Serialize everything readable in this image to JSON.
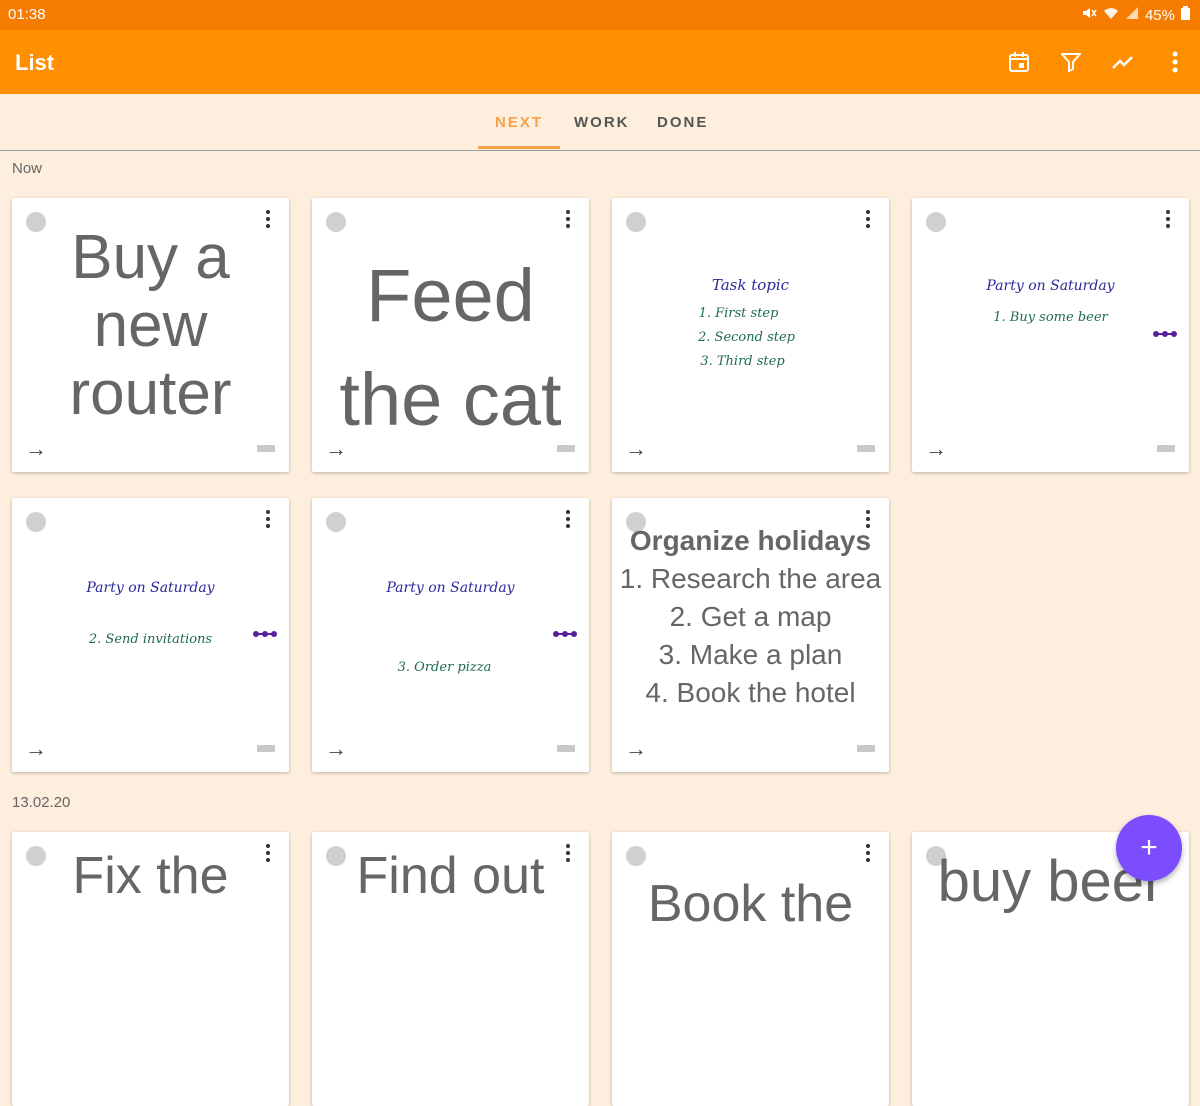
{
  "status_bar": {
    "time": "01:38",
    "battery": "45%"
  },
  "app_bar": {
    "title": "List",
    "icons": [
      "calendar-icon",
      "filter-icon",
      "trending-icon",
      "more-vert-icon"
    ]
  },
  "tabs": [
    {
      "label": "NEXT",
      "active": true
    },
    {
      "label": "WORK"
    },
    {
      "label": "DONE"
    }
  ],
  "sections": {
    "now": "Now",
    "date": "13.02.20"
  },
  "cards": {
    "c1": "Buy a new router",
    "c2": "Feed the cat",
    "c3": {
      "title": "Task topic",
      "line1": "1. First step",
      "line2": "2. Second step",
      "line3": "3. Third step"
    },
    "c4": {
      "title": "Party on Saturday",
      "line1": "1. Buy some beer"
    },
    "c5": {
      "title": "Party on Saturday",
      "line1": "2. Send invitations"
    },
    "c6": {
      "title": "Party on Saturday",
      "line1": "3. Order pizza"
    },
    "c7": {
      "title": "Organize holidays",
      "items": [
        "1. Research the area",
        "2. Get a map",
        "3. Make a plan",
        "4. Book the hotel"
      ]
    },
    "c8": "Fix the",
    "c9": "Find out",
    "c10": "Book the",
    "c11": "buy beer"
  },
  "colors": {
    "status_bar": "#f57c00",
    "app_bar": "#ff8f00",
    "background": "#fdeedd",
    "accent_tab": "#f7a14a",
    "fab": "#7c4dff",
    "ink_blue": "#2a2a9a",
    "ink_green": "#1e6b4e",
    "dots_purple": "#5a1f9e"
  }
}
